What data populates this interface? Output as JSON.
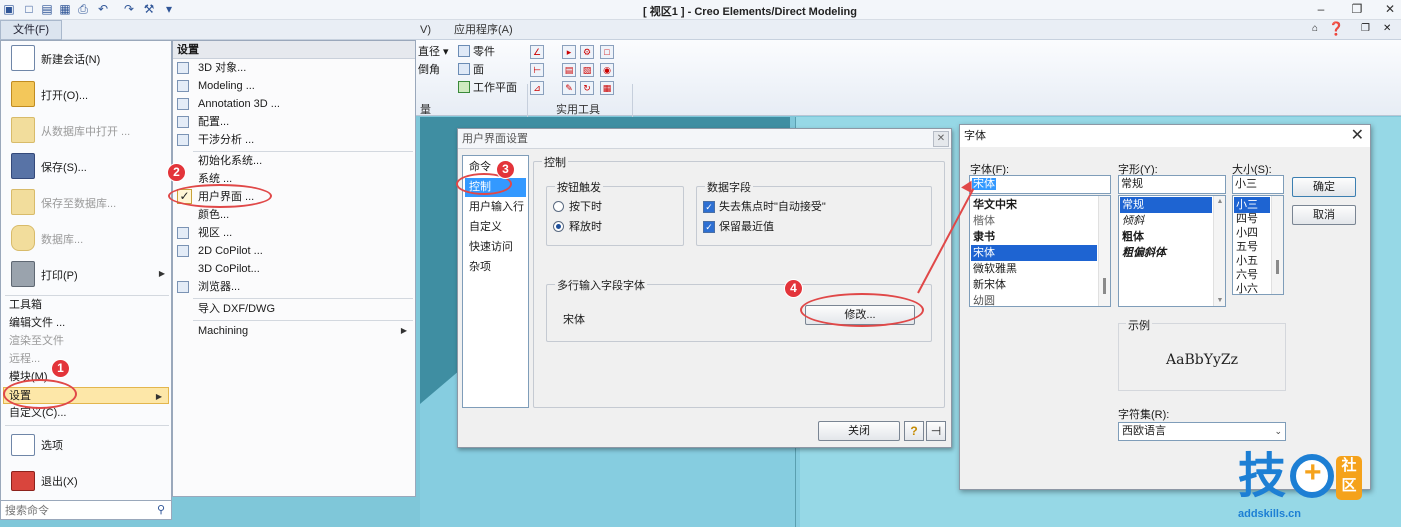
{
  "app": {
    "title": "[ 视区1 ] - Creo Elements/Direct Modeling"
  },
  "ribbon": {
    "file_tab": "文件(F)",
    "tabs": [
      "V)",
      "应用程序(A)"
    ],
    "buttons": [
      "直径",
      "零件",
      "倒角",
      "面",
      "工作平面"
    ],
    "group_labels": [
      "量",
      "实用工具"
    ]
  },
  "file_menu": {
    "big_items": [
      {
        "label": "新建会话(N)",
        "disabled": false
      },
      {
        "label": "打开(O)...",
        "disabled": false
      },
      {
        "label": "从数据库中打开 ...",
        "disabled": true
      },
      {
        "label": "保存(S)...",
        "disabled": false
      },
      {
        "label": "保存至数据库...",
        "disabled": true
      },
      {
        "label": "数据库...",
        "disabled": true
      },
      {
        "label": "打印(P)",
        "disabled": false
      }
    ],
    "small_items": [
      {
        "label": "工具箱",
        "disabled": false
      },
      {
        "label": "编辑文件 ...",
        "disabled": false
      },
      {
        "label": "渲染至文件",
        "disabled": true
      },
      {
        "label": "远程...",
        "disabled": true
      },
      {
        "label": "模块(M)",
        "disabled": false
      },
      {
        "label": "设置",
        "disabled": false
      },
      {
        "label": "自定义(C)...",
        "disabled": false
      }
    ],
    "bottom_items": [
      {
        "label": "选项"
      },
      {
        "label": "退出(X)"
      }
    ],
    "search_placeholder": "搜索命令"
  },
  "settings_menu": {
    "header": "设置",
    "items": [
      "3D 对象...",
      "Modeling ...",
      "Annotation 3D ...",
      "配置...",
      "干涉分析 ...",
      "初始化系统...",
      "系统 ...",
      "用户界面 ...",
      "颜色...",
      "视区 ...",
      "2D CoPilot ...",
      "3D CoPilot...",
      "浏览器...",
      "导入 DXF/DWG",
      "Machining"
    ]
  },
  "ui_dialog": {
    "title": "用户界面设置",
    "nav": [
      "命令",
      "控制",
      "用户输入行",
      "自定义",
      "快速访问",
      "杂项"
    ],
    "main_group": "控制",
    "button_trigger_group": "按钮触发",
    "radio_press": "按下时",
    "radio_release": "释放时",
    "data_field_group": "数据字段",
    "check_autoaccept": "失去焦点时\"自动接受\"",
    "check_keep_recent": "保留最近值",
    "multiline_group": "多行输入字段字体",
    "font_name": "宋体",
    "modify_button": "修改...",
    "close_button": "关闭"
  },
  "font_dialog": {
    "title": "字体",
    "font_label": "字体(F):",
    "style_label": "字形(Y):",
    "size_label": "大小(S):",
    "font_value": "宋体",
    "style_value": "常规",
    "size_value": "小三",
    "fonts": [
      "华文中宋",
      "楷体",
      "隶书",
      "宋体",
      "微软雅黑",
      "新宋体",
      "幼圆"
    ],
    "styles": [
      "常规",
      "倾斜",
      "粗体",
      "粗偏斜体"
    ],
    "sizes": [
      "小三",
      "四号",
      "小四",
      "五号",
      "小五",
      "六号",
      "小六"
    ],
    "ok_button": "确定",
    "cancel_button": "取消",
    "sample_label": "示例",
    "sample_text": "AaBbYyZz",
    "charset_label": "字符集(R):",
    "charset_value": "西欧语言"
  },
  "badges": [
    "1",
    "2",
    "3",
    "4"
  ],
  "logo": {
    "main": "技",
    "plus": "+",
    "tag_top": "社",
    "tag_bottom": "区",
    "url": "addskills.cn"
  }
}
